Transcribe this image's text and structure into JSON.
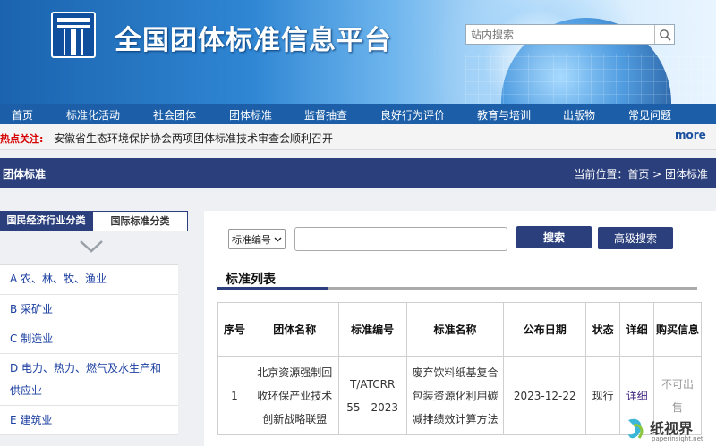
{
  "header": {
    "site_title": "全国团体标准信息平台",
    "search_placeholder": "站内搜索"
  },
  "nav": {
    "items": [
      "首页",
      "标准化活动",
      "社会团体",
      "团体标准",
      "监督抽查",
      "良好行为评价",
      "教育与培训",
      "出版物",
      "常见问题"
    ]
  },
  "hot": {
    "label": "热点关注:",
    "text": "安徽省生态环境保护协会两项团体标准技术审查会顺利召开",
    "more": "more"
  },
  "section": {
    "title": "团体标准",
    "breadcrumb": "当前位置：首页 > 团体标准"
  },
  "left": {
    "tabs": [
      "国民经济行业分类",
      "国际标准分类"
    ],
    "categories": [
      "A 农、林、牧、渔业",
      "B 采矿业",
      "C 制造业",
      "D 电力、热力、燃气及水生产和供应业",
      "E 建筑业"
    ]
  },
  "search_form": {
    "select_value": "标准编号",
    "search_label": "搜索",
    "advanced_label": "高级搜索"
  },
  "list": {
    "title": "标准列表",
    "columns": [
      "序号",
      "团体名称",
      "标准编号",
      "标准名称",
      "公布日期",
      "状态",
      "详细",
      "购买信息"
    ],
    "rows": [
      {
        "index": "1",
        "org": "北京资源强制回收环保产业技术创新战略联盟",
        "code": "T/ATCRR 55—2023",
        "name": "废弃饮料纸基复合包装资源化利用碳减排绩效计算方法",
        "date": "2023-12-22",
        "status": "现行",
        "detail": "详细",
        "purchase": "不可出售"
      }
    ]
  },
  "watermark": {
    "text": "纸视界",
    "url": "paperinsight.net"
  },
  "colors": {
    "nav_blue": "#1c5fa8",
    "dark_navy": "#2a3f7c",
    "hot_red": "#d60000",
    "link_blue": "#1b3fa0"
  }
}
